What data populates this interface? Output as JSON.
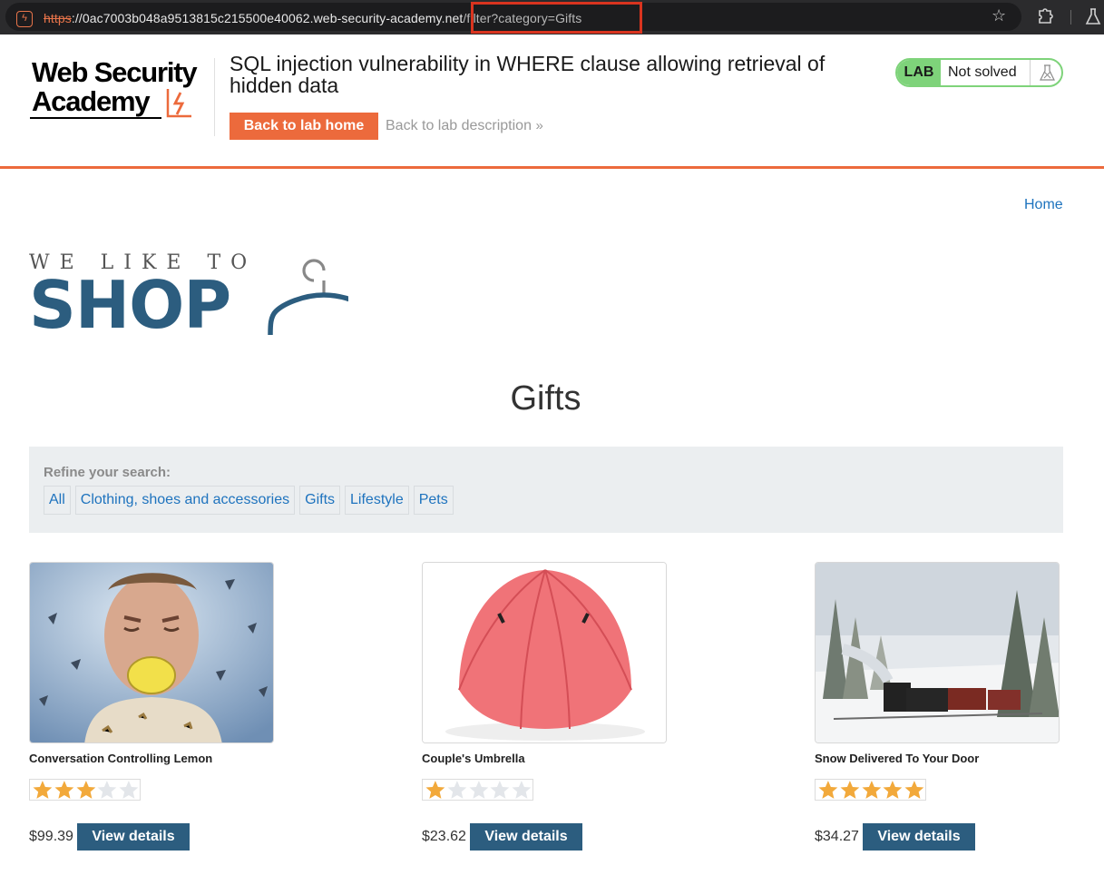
{
  "browser": {
    "url_protocol": "https",
    "url_host": "://0ac7003b048a9513815c215500e40062.web-security-academy.",
    "url_host_tail": "net",
    "url_path": "/filter?category=Gifts"
  },
  "academy": {
    "logo_line1": "Web Security",
    "logo_line2": "Academy",
    "lab_title": "SQL injection vulnerability in WHERE clause allowing retrieval of hidden data",
    "back_home_label": "Back to lab home",
    "back_description_label": "Back to lab description",
    "status_badge": "LAB",
    "status_text": "Not solved",
    "accent_color": "#ec6a3c",
    "solved_color": "#7ed37a"
  },
  "shop": {
    "home_link": "Home",
    "tagline": "WE LIKE TO",
    "logo_word": "SHOP",
    "page_title": "Gifts",
    "filter_label": "Refine your search:",
    "filters": [
      "All",
      "Clothing, shoes and accessories",
      "Gifts",
      "Lifestyle",
      "Pets"
    ],
    "brand_color": "#2c5d7f"
  },
  "products": [
    {
      "name": "Conversation Controlling Lemon",
      "rating": 3,
      "price": "$99.39",
      "button": "View details",
      "image": "man-biting-lemon"
    },
    {
      "name": "Couple's Umbrella",
      "rating": 1,
      "price": "$23.62",
      "button": "View details",
      "image": "red-umbrella"
    },
    {
      "name": "Snow Delivered To Your Door",
      "rating": 5,
      "price": "$34.27",
      "button": "View details",
      "image": "steam-train-in-snow"
    }
  ]
}
